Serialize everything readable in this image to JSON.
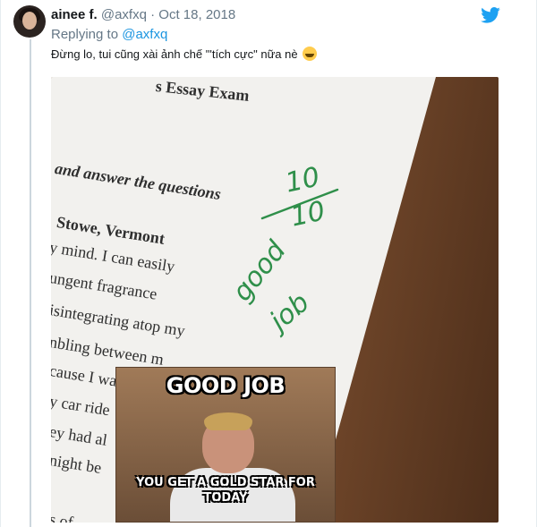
{
  "tweet": {
    "author_name": "ainee f.",
    "handle": "@axfxq",
    "separator": "·",
    "date": "Oct 18, 2018",
    "reply_prefix": "Replying to",
    "reply_to": "@axfxq",
    "text": "Đừng lo, tui cũng xài ảnh chế \"'tích cực\" nữa nè"
  },
  "photo": {
    "paper_lines": [
      "s Essay Exam",
      "and answer the questions",
      "Stowe, Vermont",
      "y mind. I can easily",
      "ungent fragrance",
      "isintegrating atop my",
      "nbling between m",
      "cause I wa",
      "y car ride",
      "ey had al",
      "night be",
      "s of"
    ],
    "grade_top": "10",
    "grade_bottom": "10",
    "handwriting_1": "good",
    "handwriting_2": "job",
    "meme_top": "GOOD JOB",
    "meme_bottom": "YOU GET A GOLD STAR FOR TODAY"
  },
  "colors": {
    "link": "#1b95e0",
    "muted": "#657786",
    "grade_ink": "#2f8f4a"
  },
  "icons": {
    "brand": "twitter-bird-icon",
    "emoji": "joy-emoji-icon"
  }
}
